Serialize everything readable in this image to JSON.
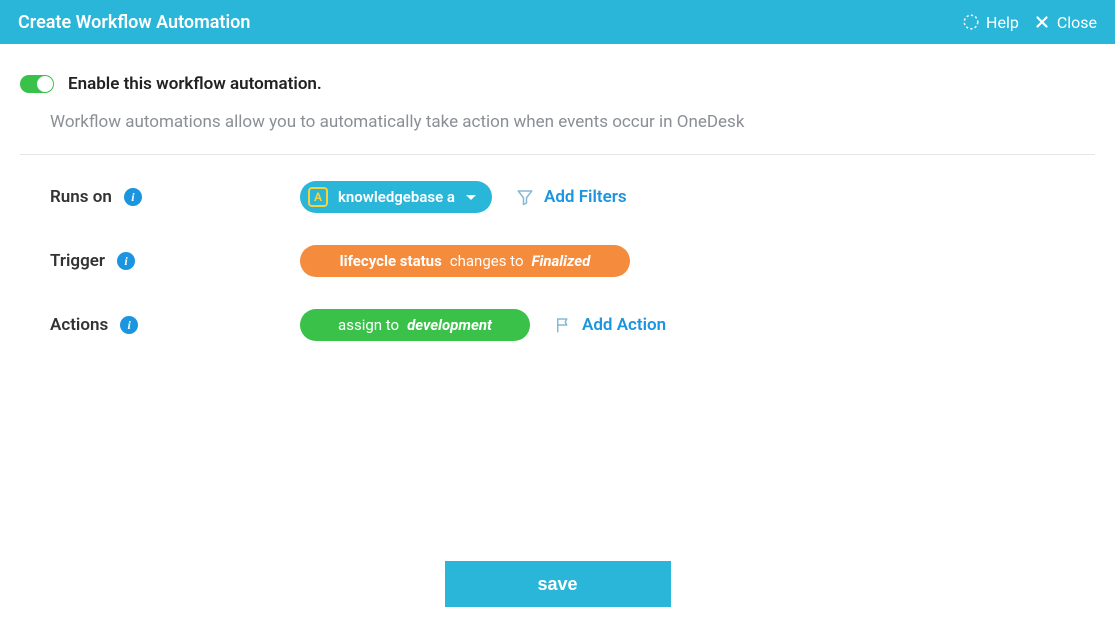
{
  "header": {
    "title": "Create Workflow Automation",
    "help_label": "Help",
    "close_label": "Close"
  },
  "enable": {
    "label": "Enable this workflow automation.",
    "on": true
  },
  "description": "Workflow automations allow you to automatically take action when events occur in OneDesk",
  "rows": {
    "runs_on": {
      "label": "Runs on",
      "chip_icon_letter": "A",
      "chip_label": "knowledgebase a",
      "add_filters": "Add Filters"
    },
    "trigger": {
      "label": "Trigger",
      "field": "lifecycle status",
      "operator": "changes to",
      "value": "Finalized"
    },
    "actions": {
      "label": "Actions",
      "verb": "assign to",
      "target": "development",
      "add_action": "Add Action"
    }
  },
  "footer": {
    "save": "save"
  },
  "colors": {
    "brand": "#29b6d8",
    "orange": "#f58b3c",
    "green": "#3ac14a",
    "link": "#1b95e0"
  }
}
